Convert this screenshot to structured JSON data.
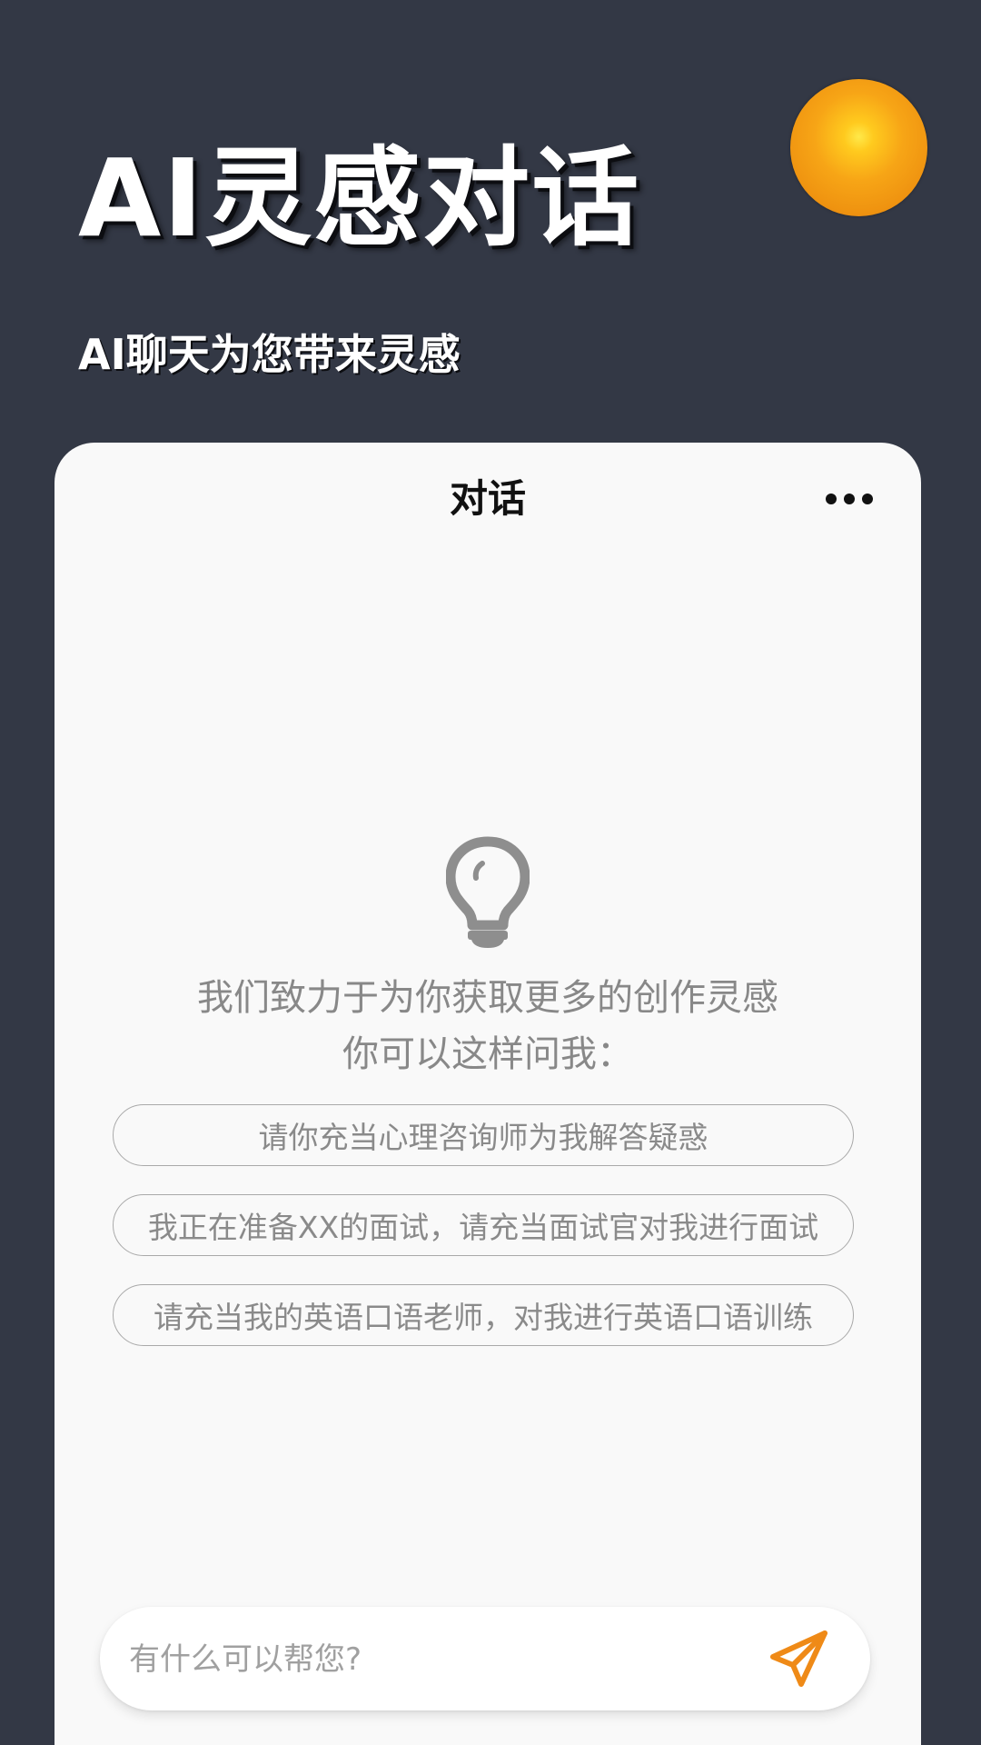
{
  "header": {
    "title": "AI灵感对话",
    "subtitle": "AI聊天为您带来灵感"
  },
  "chat": {
    "title": "对话",
    "more_icon": "more-horizontal-icon",
    "empty_icon": "lightbulb-icon",
    "intro_line1": "我们致力于为你获取更多的创作灵感",
    "intro_line2": "你可以这样问我：",
    "suggestions": [
      {
        "label": "请你充当心理咨询师为我解答疑惑"
      },
      {
        "label": "我正在准备XX的面试，请充当面试官对我进行面试"
      },
      {
        "label": "请充当我的英语口语老师，对我进行英语口语训练"
      }
    ],
    "input": {
      "value": "",
      "placeholder": "有什么可以帮您?"
    },
    "send_icon": "send-paper-plane-icon"
  },
  "colors": {
    "background": "#333845",
    "card": "#f9f9f9",
    "accent": "#ef8a17",
    "orb": "#f5a015"
  }
}
